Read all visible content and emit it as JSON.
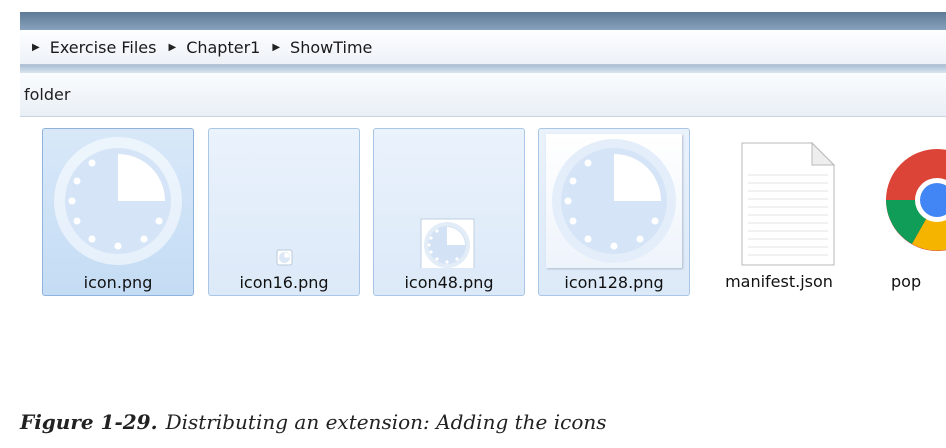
{
  "address_bar": {
    "crumbs": [
      "Exercise Files",
      "Chapter1",
      "ShowTime"
    ]
  },
  "toolbar": {
    "label": "folder"
  },
  "files": [
    {
      "name": "icon.png",
      "icon": "clock-icon-large"
    },
    {
      "name": "icon16.png",
      "icon": "clock-icon-tiny"
    },
    {
      "name": "icon48.png",
      "icon": "clock-icon-medium"
    },
    {
      "name": "icon128.png",
      "icon": "clock-icon-large"
    },
    {
      "name": "manifest.json",
      "icon": "document-icon"
    },
    {
      "name": "pop",
      "icon": "chrome-icon"
    }
  ],
  "caption": {
    "figure": "Figure 1-29.",
    "text": "Distributing an extension: Adding the icons"
  },
  "colors": {
    "selection": "#c4dcf4",
    "selection_border": "#8fb3dc",
    "address_bar": "#edf2f8",
    "top_strip": "#5f7a96"
  }
}
